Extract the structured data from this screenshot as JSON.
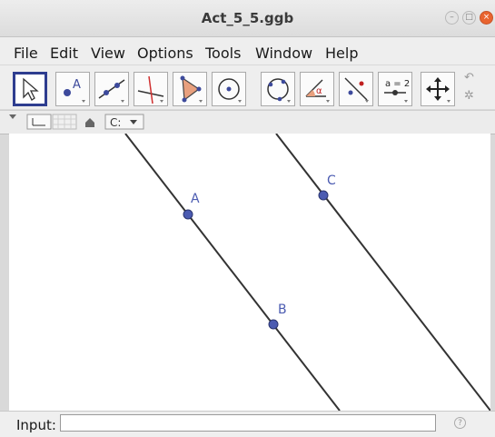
{
  "window": {
    "title": "Act_5_5.ggb"
  },
  "menu": [
    "File",
    "Edit",
    "View",
    "Options",
    "Tools",
    "Window",
    "Help"
  ],
  "toolbar": {
    "tools": [
      {
        "name": "move-tool-button",
        "icon": "cursor-arrow-icon",
        "selected": true
      },
      {
        "name": "point-tool-button",
        "icon": "point-icon",
        "label": "A"
      },
      {
        "name": "line-tool-button",
        "icon": "line-through-points-icon"
      },
      {
        "name": "perpendicular-tool-button",
        "icon": "perpendicular-line-icon"
      },
      {
        "name": "polygon-tool-button",
        "icon": "polygon-icon"
      },
      {
        "name": "circle-tool-button",
        "icon": "circle-center-point-icon"
      },
      {
        "name": "circle-three-points-tool-button",
        "icon": "circle-three-points-icon"
      },
      {
        "name": "angle-tool-button",
        "icon": "angle-icon",
        "label": "α"
      },
      {
        "name": "reflect-tool-button",
        "icon": "reflect-about-line-icon"
      },
      {
        "name": "slider-tool-button",
        "icon": "slider-icon",
        "label": "a = 2"
      },
      {
        "name": "move-graphics-tool-button",
        "icon": "move-graphics-view-icon"
      }
    ],
    "undo_icon": "undo-icon",
    "settings_icon": "gear-icon"
  },
  "stylebar": {
    "icons": [
      "axes-toggle-icon",
      "grid-toggle-icon",
      "home-icon",
      "point-capture-icon"
    ]
  },
  "graphics": {
    "points": [
      {
        "label": "A"
      },
      {
        "label": "B"
      },
      {
        "label": "C"
      }
    ],
    "colors": {
      "point": "#4b5bb1",
      "line": "#333333"
    }
  },
  "input_bar": {
    "label": "Input:",
    "value": "",
    "help_icon": "help-icon"
  }
}
